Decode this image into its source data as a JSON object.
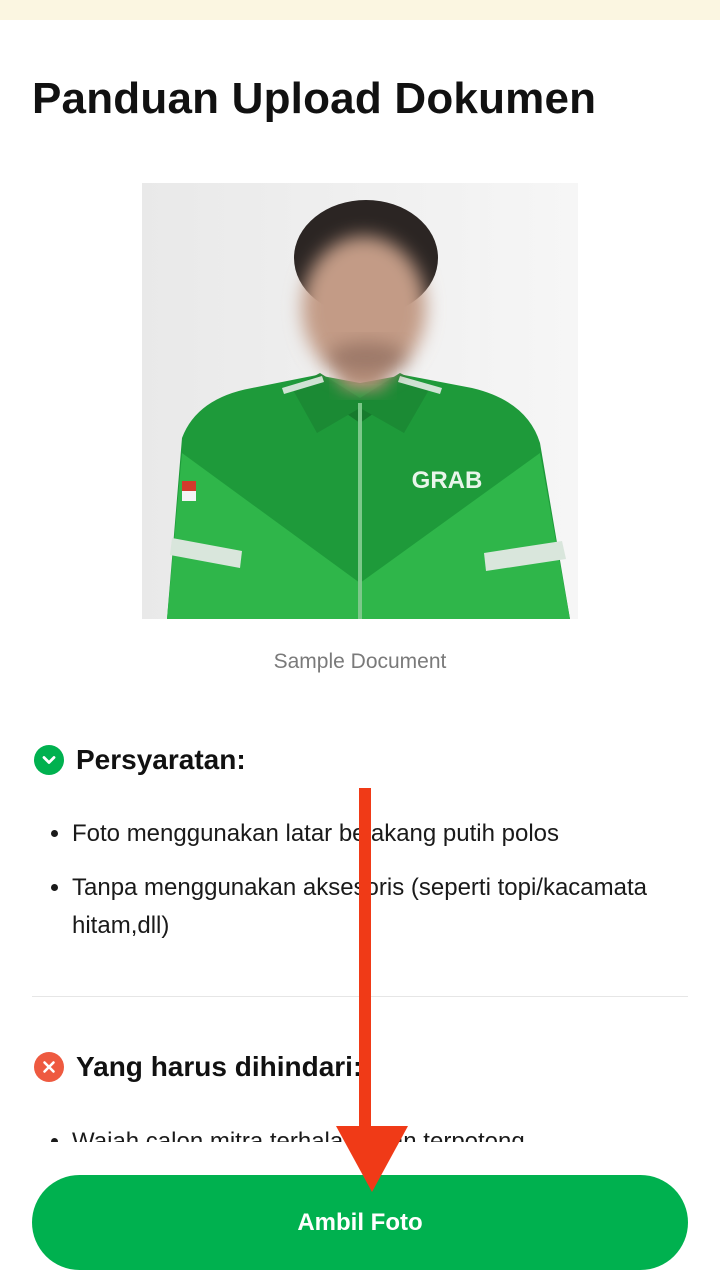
{
  "page": {
    "title": "Panduan Upload Dokumen"
  },
  "sample": {
    "caption": "Sample Document",
    "jacket_logo_text": "GRAB"
  },
  "requirements": {
    "heading": "Persyaratan:",
    "icon": "check-circle-icon",
    "items": [
      "Foto menggunakan latar belakang putih polos",
      "Tanpa menggunakan aksesoris (seperti topi/kacamata hitam,dll)"
    ]
  },
  "avoid": {
    "heading": "Yang harus dihindari:",
    "icon": "x-circle-icon",
    "items": [
      "Wajah calon mitra terhalang dan terpotong"
    ]
  },
  "actions": {
    "primary_label": "Ambil Foto"
  },
  "colors": {
    "brand_green": "#00b14f",
    "danger": "#ee5a40",
    "annotation_arrow": "#f03a17",
    "top_strip": "#fbf6e1"
  }
}
